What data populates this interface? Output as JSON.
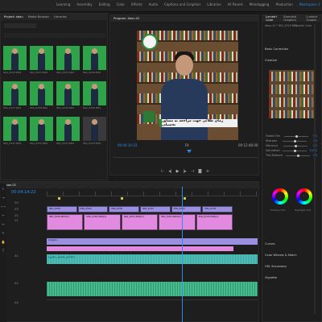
{
  "menu": [
    "Learning",
    "Assembly",
    "Editing",
    "Color",
    "Effects",
    "Audio",
    "Captions and Graphics",
    "Libraries",
    "All Panels",
    "Metalogging",
    "Production",
    "Workspace 1"
  ],
  "menu_active": 11,
  "right_tabs": [
    "Lumetri Color",
    "Essential Graphics",
    "Lumetri Scopes"
  ],
  "project": {
    "tabs": [
      "Project: aban",
      "Media Browser",
      "Libraries"
    ],
    "search_placeholder": "",
    "clips": [
      {
        "label": "IMG_6323.MP4"
      },
      {
        "label": "IMG_6324.MP4"
      },
      {
        "label": "IMG_6325.MP4"
      },
      {
        "label": "IMG_6326.MP4"
      },
      {
        "label": "IMG_6327.MP4"
      },
      {
        "label": "IMG_6328.MP4"
      },
      {
        "label": "IMG_6329.MP4"
      },
      {
        "label": "IMG_6330.MP4"
      },
      {
        "label": "IMG_6331.MP4"
      },
      {
        "label": "IMG_6332.MP4"
      },
      {
        "label": "IMG_6333.MP4"
      },
      {
        "label": "IMG_6334.MP4"
      }
    ]
  },
  "program": {
    "title": "Program: Aban.02",
    "timecode_left": "00:04:14:22",
    "timecode_right": "00:12:48:00",
    "fit": "Fit",
    "caption": "زمان طلائی جهت مراجعه به مشاور تحصیلی"
  },
  "lumetri": {
    "header": "Lumetri Color",
    "source": "Aban.02 * IMG_6329.MP4",
    "preset": "Lumetri Color",
    "sections": [
      "Basic Correction",
      "Creative",
      "Curves",
      "Color Wheels & Match",
      "HSL Secondary",
      "Vignette"
    ],
    "sliders": [
      {
        "label": "Faded Film",
        "value": "0.0"
      },
      {
        "label": "Sharpen",
        "value": "0.0"
      },
      {
        "label": "Vibrance",
        "value": "0.0"
      },
      {
        "label": "Saturation",
        "value": "100.0"
      },
      {
        "label": "Tint Balance",
        "value": "0.0"
      }
    ],
    "wheel_labels": [
      "Shadow Tint",
      "Highlight Tint"
    ]
  },
  "timeline": {
    "title": "Aban.02",
    "timecode": "00:04:14:22",
    "tracks": [
      {
        "name": "V4"
      },
      {
        "name": "V3"
      },
      {
        "name": "V2"
      },
      {
        "name": "V1"
      },
      {
        "name": "A1"
      },
      {
        "name": "A2"
      },
      {
        "name": "A3"
      }
    ],
    "v2_clips": [
      "IMG_6329",
      "IMG_6329",
      "IMG_6330",
      "IMG_6332",
      "IMG_6333",
      "IMG_6334"
    ],
    "v1_clips": [
      "IMG_6329.MP4[V]",
      "IMG_6330.MP4[V]",
      "IMG_6331.MP4[V]",
      "IMG_6332.MP4[V]",
      "IMG_6333.MP4[V]"
    ],
    "title_clip": "Graphic",
    "audio_clip": "اس تحصیلی مشاوره.wav"
  },
  "colors": {
    "accent": "#2d8ceb",
    "video_clip": "#9a8fe0",
    "pink_clip": "#e08ae0",
    "audio_clip": "#3aa6a0",
    "green_clip": "#2f9b74"
  }
}
